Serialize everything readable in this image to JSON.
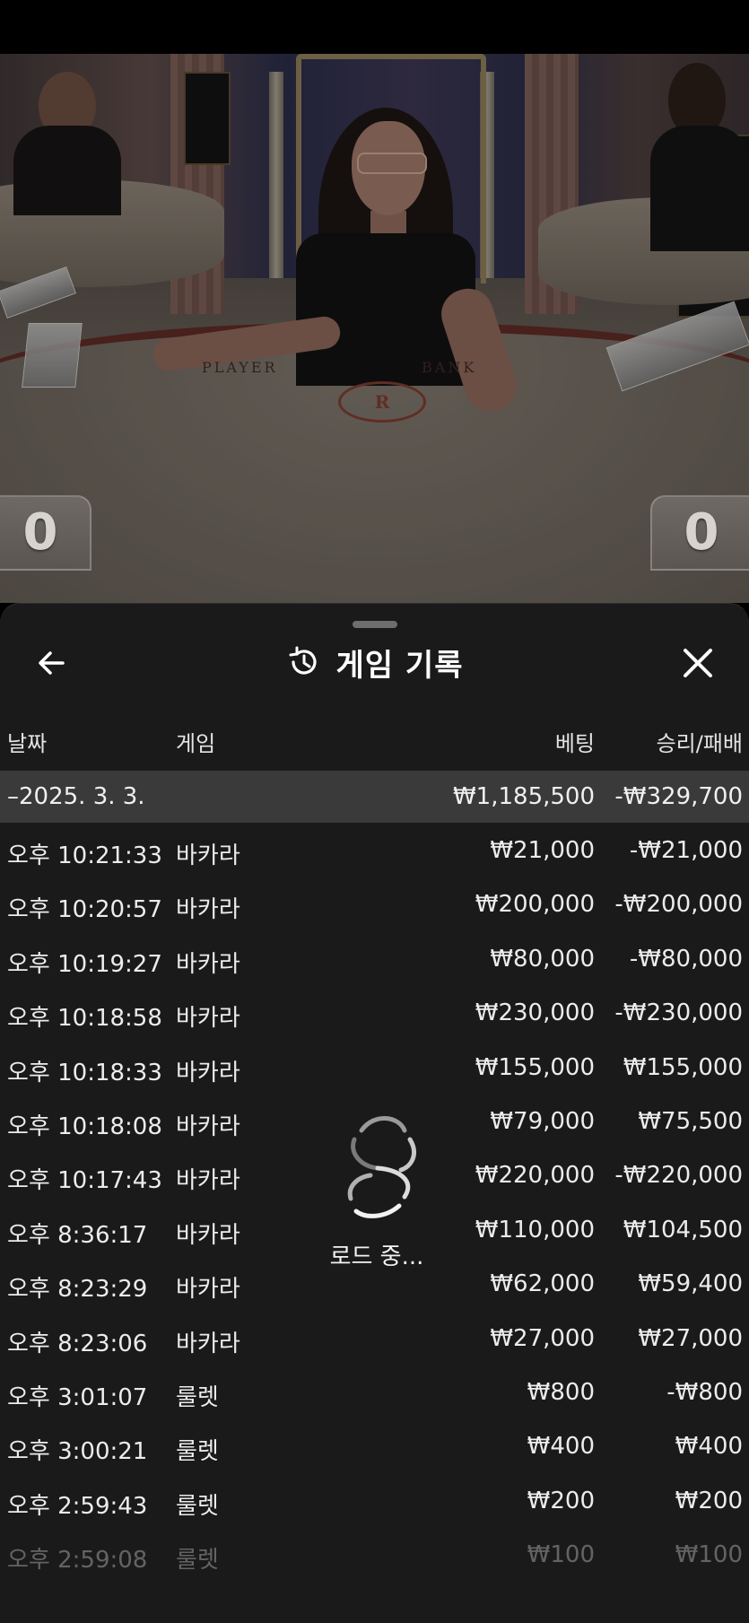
{
  "video": {
    "felt_left_label": "PLAYER",
    "felt_right_label": "BANK",
    "logo_letter": "R",
    "score_left": "0",
    "score_right": "0"
  },
  "header": {
    "title": "게임 기록",
    "back_icon": "arrow-left-icon",
    "history_icon": "history-clock-icon",
    "close_icon": "close-icon"
  },
  "columns": {
    "date": "날짜",
    "game": "게임",
    "bet": "베팅",
    "result": "승리/패배"
  },
  "summary": {
    "date": "–2025. 3. 3.",
    "bet": "₩1,185,500",
    "result": "-₩329,700"
  },
  "rows": [
    {
      "time": "오후 10:21:33",
      "game": "바카라",
      "bet": "₩21,000",
      "result": "-₩21,000"
    },
    {
      "time": "오후 10:20:57",
      "game": "바카라",
      "bet": "₩200,000",
      "result": "-₩200,000"
    },
    {
      "time": "오후 10:19:27",
      "game": "바카라",
      "bet": "₩80,000",
      "result": "-₩80,000"
    },
    {
      "time": "오후 10:18:58",
      "game": "바카라",
      "bet": "₩230,000",
      "result": "-₩230,000"
    },
    {
      "time": "오후 10:18:33",
      "game": "바카라",
      "bet": "₩155,000",
      "result": "₩155,000"
    },
    {
      "time": "오후 10:18:08",
      "game": "바카라",
      "bet": "₩79,000",
      "result": "₩75,500"
    },
    {
      "time": "오후 10:17:43",
      "game": "바카라",
      "bet": "₩220,000",
      "result": "-₩220,000"
    },
    {
      "time": "오후 8:36:17",
      "game": "바카라",
      "bet": "₩110,000",
      "result": "₩104,500"
    },
    {
      "time": "오후 8:23:29",
      "game": "바카라",
      "bet": "₩62,000",
      "result": "₩59,400"
    },
    {
      "time": "오후 8:23:06",
      "game": "바카라",
      "bet": "₩27,000",
      "result": "₩27,000"
    },
    {
      "time": "오후 3:01:07",
      "game": "룰렛",
      "bet": "₩800",
      "result": "-₩800"
    },
    {
      "time": "오후 3:00:21",
      "game": "룰렛",
      "bet": "₩400",
      "result": "₩400"
    },
    {
      "time": "오후 2:59:43",
      "game": "룰렛",
      "bet": "₩200",
      "result": "₩200"
    },
    {
      "time": "오후 2:59:08",
      "game": "룰렛",
      "bet": "₩100",
      "result": "₩100"
    }
  ],
  "loader": {
    "label": "로드 중...",
    "icon": "loading-spinner-icon"
  }
}
